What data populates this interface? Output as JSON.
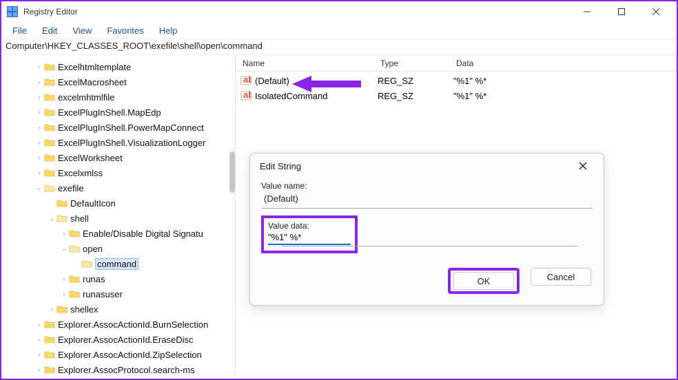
{
  "titlebar": {
    "title": "Registry Editor"
  },
  "menu": {
    "file": "File",
    "edit": "Edit",
    "view": "View",
    "favorites": "Favorites",
    "help": "Help"
  },
  "address": "Computer\\HKEY_CLASSES_ROOT\\exefile\\shell\\open\\command",
  "tree": {
    "items": [
      {
        "label": "Excelhtmltemplate",
        "depth": 2,
        "twisty": ">"
      },
      {
        "label": "ExcelMacrosheet",
        "depth": 2,
        "twisty": ">"
      },
      {
        "label": "excelmhtmlfile",
        "depth": 2,
        "twisty": ">"
      },
      {
        "label": "ExcelPlugInShell.MapEdp",
        "depth": 2,
        "twisty": ">"
      },
      {
        "label": "ExcelPlugInShell.PowerMapConnect",
        "depth": 2,
        "twisty": ">"
      },
      {
        "label": "ExcelPlugInShell.VisualizationLogger",
        "depth": 2,
        "twisty": ">"
      },
      {
        "label": "ExcelWorksheet",
        "depth": 2,
        "twisty": ">"
      },
      {
        "label": "Excelxmlss",
        "depth": 2,
        "twisty": ">"
      },
      {
        "label": "exefile",
        "depth": 2,
        "twisty": "v"
      },
      {
        "label": "DefaultIcon",
        "depth": 3,
        "twisty": ""
      },
      {
        "label": "shell",
        "depth": 3,
        "twisty": "v"
      },
      {
        "label": "Enable/Disable Digital Signatu",
        "depth": 4,
        "twisty": ">"
      },
      {
        "label": "open",
        "depth": 4,
        "twisty": "v"
      },
      {
        "label": "command",
        "depth": 5,
        "twisty": "",
        "selected": true
      },
      {
        "label": "runas",
        "depth": 4,
        "twisty": ">"
      },
      {
        "label": "runasuser",
        "depth": 4,
        "twisty": ">"
      },
      {
        "label": "shellex",
        "depth": 3,
        "twisty": ">"
      },
      {
        "label": "Explorer.AssocActionId.BurnSelection",
        "depth": 2,
        "twisty": ">"
      },
      {
        "label": "Explorer.AssocActionId.EraseDisc",
        "depth": 2,
        "twisty": ">"
      },
      {
        "label": "Explorer.AssocActionId.ZipSelection",
        "depth": 2,
        "twisty": ">"
      },
      {
        "label": "Explorer.AssocProtocol.search-ms",
        "depth": 2,
        "twisty": ">"
      }
    ]
  },
  "list": {
    "cols": {
      "name": "Name",
      "type": "Type",
      "data": "Data"
    },
    "rows": [
      {
        "name": "(Default)",
        "type": "REG_SZ",
        "data": "\"%1\" %*"
      },
      {
        "name": "IsolatedCommand",
        "type": "REG_SZ",
        "data": "\"%1\" %*"
      }
    ]
  },
  "dialog": {
    "title": "Edit String",
    "vn_label": "Value name:",
    "vn_value": "(Default)",
    "vd_label": "Value data:",
    "vd_value": "\"%1\" %*",
    "ok": "OK",
    "cancel": "Cancel"
  },
  "highlight_color": "#8a24e8"
}
